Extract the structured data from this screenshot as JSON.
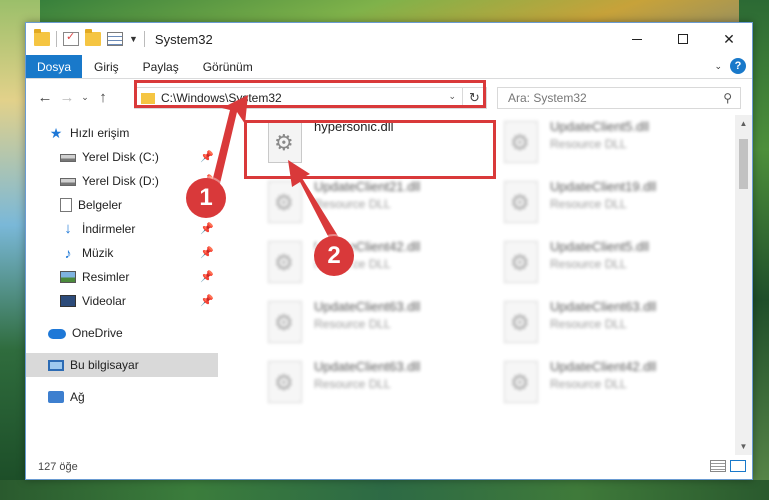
{
  "window": {
    "title": "System32",
    "controls": {
      "minimize": "minimize-button",
      "maximize": "maximize-button",
      "close": "✕"
    }
  },
  "ribbon": {
    "tabs": [
      "Dosya",
      "Giriş",
      "Paylaş",
      "Görünüm"
    ]
  },
  "address": {
    "path": "C:\\Windows\\System32",
    "search_placeholder": "Ara: System32"
  },
  "nav": {
    "items": [
      {
        "label": "Hızlı erişim",
        "icon": "star-icon"
      },
      {
        "label": "Yerel Disk (C:)",
        "icon": "disk-icon",
        "pinned": true
      },
      {
        "label": "Yerel Disk (D:)",
        "icon": "disk-icon",
        "pinned": true
      },
      {
        "label": "Belgeler",
        "icon": "document-icon",
        "pinned": true
      },
      {
        "label": "İndirmeler",
        "icon": "download-icon",
        "pinned": true
      },
      {
        "label": "Müzik",
        "icon": "music-icon",
        "pinned": true
      },
      {
        "label": "Resimler",
        "icon": "pictures-icon",
        "pinned": true
      },
      {
        "label": "Videolar",
        "icon": "videos-icon",
        "pinned": true
      },
      {
        "label": "OneDrive",
        "icon": "onedrive-icon"
      },
      {
        "label": "Bu bilgisayar",
        "icon": "computer-icon",
        "selected": true
      },
      {
        "label": "Ağ",
        "icon": "network-icon"
      }
    ]
  },
  "files": [
    {
      "name": "hypersonic.dll",
      "type": ""
    },
    {
      "name": "UpdateClient5.dll",
      "type": "Resource DLL"
    },
    {
      "name": "UpdateClient21.dll",
      "type": "Resource DLL"
    },
    {
      "name": "UpdateClient19.dll",
      "type": "Resource DLL"
    },
    {
      "name": "UpdateClient42.dll",
      "type": "Resource DLL"
    },
    {
      "name": "UpdateClient5.dll",
      "type": "Resource DLL"
    },
    {
      "name": "UpdateClient63.dll",
      "type": "Resource DLL"
    },
    {
      "name": "UpdateClient63.dll",
      "type": "Resource DLL"
    },
    {
      "name": "UpdateClient63.dll",
      "type": "Resource DLL"
    },
    {
      "name": "UpdateClient42.dll",
      "type": "Resource DLL"
    }
  ],
  "status": {
    "count": "127 öğe"
  },
  "callouts": {
    "one": "1",
    "two": "2"
  },
  "colors": {
    "accent": "#1979ca",
    "highlight": "#d9393a"
  }
}
